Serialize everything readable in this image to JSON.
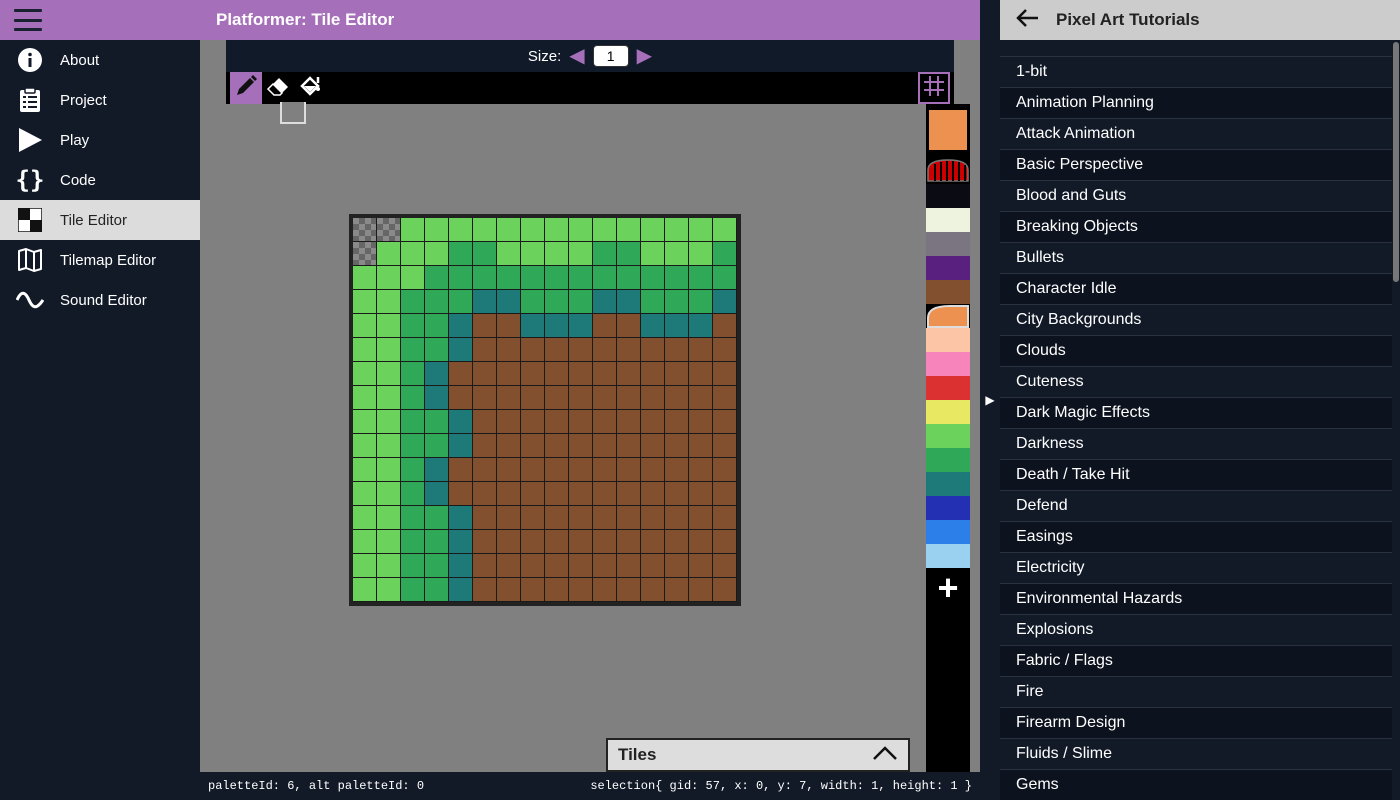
{
  "sidebar": {
    "items": [
      {
        "label": "About",
        "icon": "info-icon",
        "active": false
      },
      {
        "label": "Project",
        "icon": "clipboard-icon",
        "active": false
      },
      {
        "label": "Play",
        "icon": "play-icon",
        "active": false
      },
      {
        "label": "Code",
        "icon": "braces-icon",
        "active": false
      },
      {
        "label": "Tile Editor",
        "icon": "tile-icon",
        "active": true
      },
      {
        "label": "Tilemap Editor",
        "icon": "map-icon",
        "active": false
      },
      {
        "label": "Sound Editor",
        "icon": "wave-icon",
        "active": false
      }
    ]
  },
  "editor": {
    "title": "Platformer: Tile Editor",
    "size_label": "Size:",
    "size_value": "1",
    "tiles_label": "Tiles"
  },
  "colors": {
    "accent": "#a66fba",
    "selected_color": "#ec914f"
  },
  "tile_palette": [
    "checker",
    "#6bd25b",
    "#2fa857",
    "#1d7a79",
    "#83502f"
  ],
  "tile_rows": [
    "0011111111111111",
    "0111221111221112",
    "1112222222222222",
    "1122233222332223",
    "1122344333443334",
    "1122344444444444",
    "1123444444444444",
    "1123444444444444",
    "1122344444444444",
    "1122344444444444",
    "1123444444444444",
    "1123444444444444",
    "1122344444444444",
    "1122344444444444",
    "1122344444444444",
    "1122344444444444"
  ],
  "palette_colors": [
    "#0b0b14",
    "#eef3e0",
    "#7a7580",
    "#5a2080",
    "#83502f",
    "#ec914f",
    "#fcc5a5",
    "#f784bb",
    "#dc3131",
    "#e8e862",
    "#6bd25b",
    "#2fa857",
    "#1d7a79",
    "#2430b4",
    "#2c7fe8",
    "#9ad0f0"
  ],
  "status": {
    "left": "paletteId: 6, alt paletteId: 0",
    "right": "selection{ gid: 57, x: 0, y: 7, width: 1, height: 1 }"
  },
  "tutorials": {
    "title": "Pixel Art Tutorials",
    "items": [
      "1-bit",
      "Animation Planning",
      "Attack Animation",
      "Basic Perspective",
      "Blood and Guts",
      "Breaking Objects",
      "Bullets",
      "Character Idle",
      "City Backgrounds",
      "Clouds",
      "Cuteness",
      "Dark Magic Effects",
      "Darkness",
      "Death / Take Hit",
      "Defend",
      "Easings",
      "Electricity",
      "Environmental Hazards",
      "Explosions",
      "Fabric / Flags",
      "Fire",
      "Firearm Design",
      "Fluids / Slime",
      "Gems"
    ]
  }
}
